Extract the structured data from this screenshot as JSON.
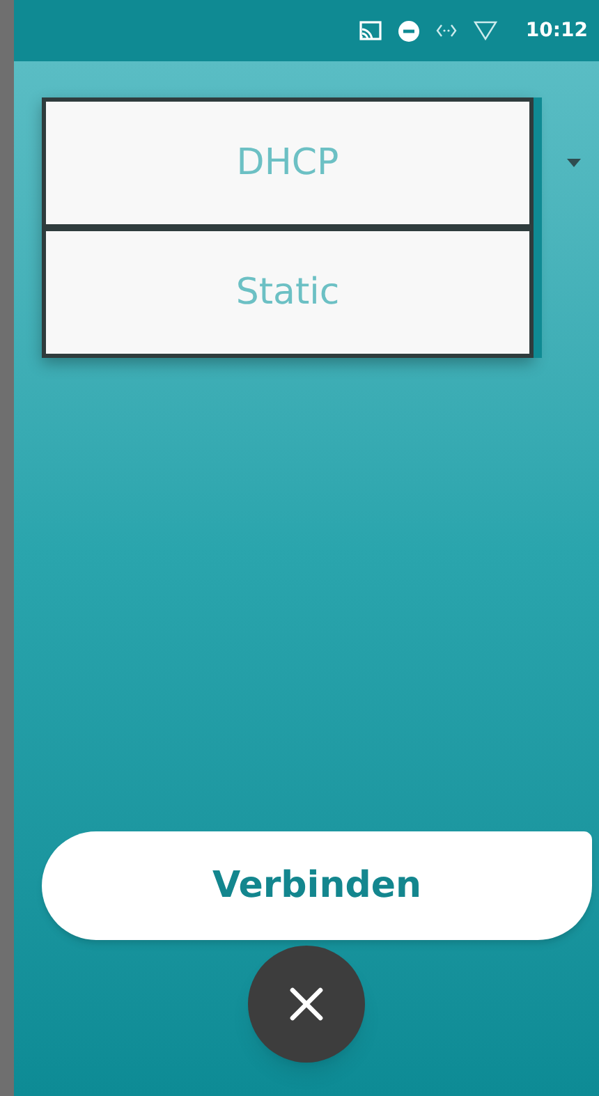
{
  "status_bar": {
    "time": "10:12"
  },
  "dropdown": {
    "options": [
      {
        "label": "DHCP"
      },
      {
        "label": "Static"
      }
    ]
  },
  "connect_button": {
    "label": "Verbinden"
  }
}
